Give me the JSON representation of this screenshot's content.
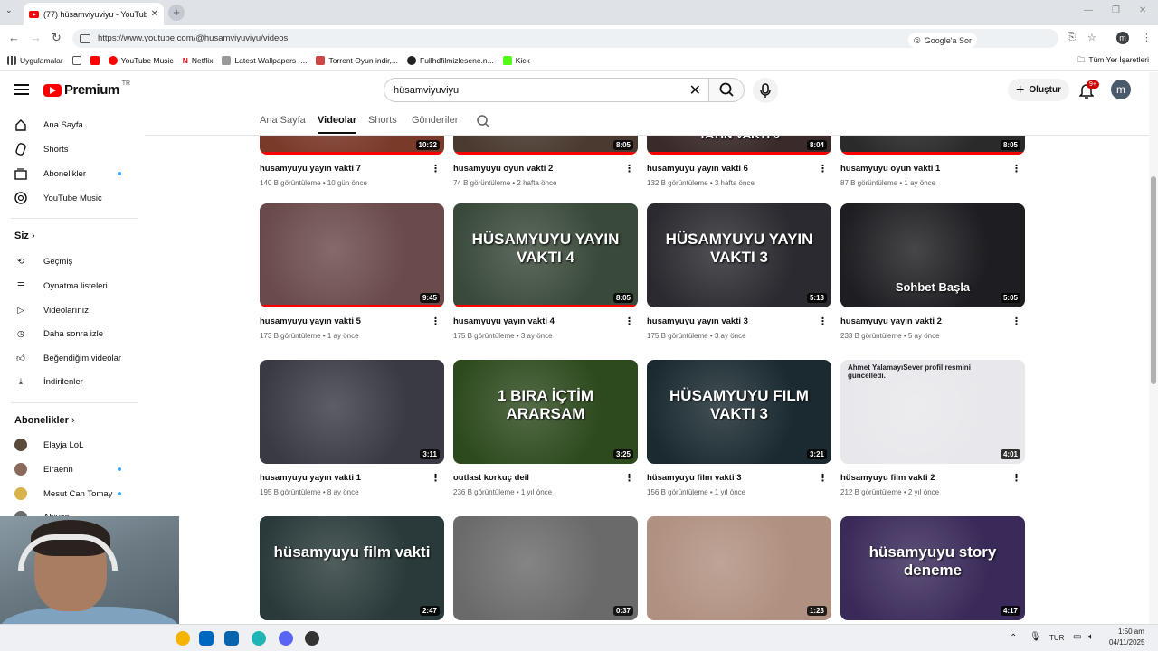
{
  "browser": {
    "tab_title": "(77) hüsamviyuviyu - YouTube",
    "url": "https://www.youtube.com/@husamviyuviyu/videos",
    "google_ask": "Google'a Sor",
    "profile_initial": "m",
    "bookmarks": [
      "Uygulamalar",
      "YouTube Music",
      "Netflix",
      "Latest Wallpapers -...",
      "Torrent Oyun indir,...",
      "Fullhdfilmizlesene.n...",
      "Kick"
    ],
    "all_bookmarks": "Tüm Yer İşaretleri"
  },
  "header": {
    "logo_text": "Premium",
    "logo_country": "TR",
    "search_value": "hüsamviyuviyu",
    "create_label": "Oluştur",
    "notif_badge": "9+",
    "avatar_initial": "m"
  },
  "sidebar": {
    "main": [
      "Ana Sayfa",
      "Shorts",
      "Abonelikler",
      "YouTube Music"
    ],
    "you_heading": "Siz",
    "you_items": [
      "Geçmiş",
      "Oynatma listeleri",
      "Videolarınız",
      "Daha sonra izle",
      "Beğendiğim videolar",
      "İndirilenler"
    ],
    "subs_heading": "Abonelikler",
    "subs": [
      "Elayja LoL",
      "Elraenn",
      "Mesut Can Tomay",
      "Ahiyan"
    ]
  },
  "tabs": [
    "Ana Sayfa",
    "Videolar",
    "Shorts",
    "Gönderiler"
  ],
  "videos": [
    {
      "title": "husamyuyu yayın vakti 7",
      "views": "140 B görüntüleme",
      "age": "10 gün önce",
      "duration": "10:32",
      "label": "",
      "color": "#7a3a2a"
    },
    {
      "title": "husamyuyu oyun vakti 2",
      "views": "74 B görüntüleme",
      "age": "2 hafta önce",
      "duration": "8:05",
      "label": "",
      "color": "#4a3a30"
    },
    {
      "title": "husamyuyu yayın vakti 6",
      "views": "132 B görüntüleme",
      "age": "3 hafta önce",
      "duration": "8:04",
      "label": "YAYIN VAKTI 6",
      "color": "#3a2a2a"
    },
    {
      "title": "husamyuyu oyun vakti 1",
      "views": "87 B görüntüleme",
      "age": "1 ay önce",
      "duration": "8:05",
      "label": "",
      "color": "#2a2a2a"
    },
    {
      "title": "husamyuyu yayın vakti 5",
      "views": "173 B görüntüleme",
      "age": "1 ay önce",
      "duration": "9:45",
      "label": "",
      "color": "#6a4a4a"
    },
    {
      "title": "husamyuyu yayın vakti 4",
      "views": "175 B görüntüleme",
      "age": "3 ay önce",
      "duration": "8:05",
      "label": "HÜSAMYUYU YAYIN VAKTI 4",
      "color": "#3a4a3a"
    },
    {
      "title": "husamyuyu yayın vakti 3",
      "views": "175 B görüntüleme",
      "age": "3 ay önce",
      "duration": "5:13",
      "label": "HÜSAMYUYU YAYIN VAKTI 3",
      "color": "#2a2a30"
    },
    {
      "title": "husamyuyu yayın vakti 2",
      "views": "233 B görüntüleme",
      "age": "5 ay önce",
      "duration": "5:05",
      "label": "Sohbet Başla",
      "color": "#1e1e22"
    },
    {
      "title": "husamyuyu yayın vakti 1",
      "views": "195 B görüntüleme",
      "age": "8 ay önce",
      "duration": "3:11",
      "label": "",
      "color": "#3a3a44"
    },
    {
      "title": "outlast korkuç deil",
      "views": "236 B görüntüleme",
      "age": "1 yıl önce",
      "duration": "3:25",
      "label": "1 BIRA İÇTİM ARARSAM",
      "color": "#2d4a1e"
    },
    {
      "title": "hüsamyuyu film vakti 3",
      "views": "156 B görüntüleme",
      "age": "1 yıl önce",
      "duration": "3:21",
      "label": "HÜSAMYUYU FILM VAKTI 3",
      "color": "#1a2a30"
    },
    {
      "title": "hüsamyuyu film vakti 2",
      "views": "212 B görüntüleme",
      "age": "2 yıl önce",
      "duration": "4:01",
      "label": "Ahmet YalamayıSever profil resmini güncelledi.",
      "color": "#e8e8ec"
    },
    {
      "title": "",
      "views": "",
      "age": "",
      "duration": "2:47",
      "label": "hüsamyuyu film vakti",
      "color": "#2a3a3a"
    },
    {
      "title": "",
      "views": "",
      "age": "",
      "duration": "0:37",
      "label": "",
      "color": "#6a6a6a"
    },
    {
      "title": "",
      "views": "",
      "age": "",
      "duration": "1:23",
      "label": "",
      "color": "#b09080"
    },
    {
      "title": "",
      "views": "",
      "age": "",
      "duration": "4:17",
      "label": "hüsamyuyu story deneme",
      "color": "#3a2a5a"
    }
  ],
  "taskbar": {
    "lang": "TUR",
    "time": "1:50 am",
    "date": "04/11/2025"
  }
}
